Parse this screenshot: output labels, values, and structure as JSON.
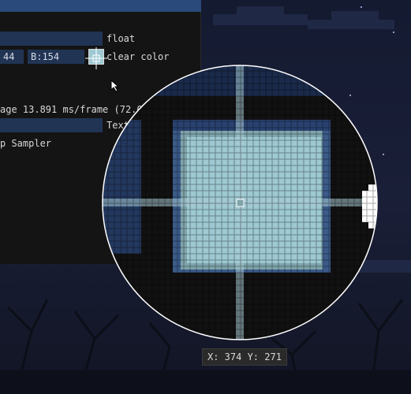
{
  "panel": {
    "float_label": "float",
    "color_r_field": "44",
    "color_b_field": "B:154",
    "clear_color_label": "clear color",
    "perf_text": "age 13.891 ms/frame (72.0",
    "text_label": "Text",
    "sampler_label": "p Sampler"
  },
  "magnifier": {
    "coords": "X: 374 Y: 271"
  },
  "colors": {
    "panel_bg": "#141414",
    "titlebar": "#294a7a",
    "field_bg": "#213454",
    "sampled_color": "#9ec9d3"
  }
}
